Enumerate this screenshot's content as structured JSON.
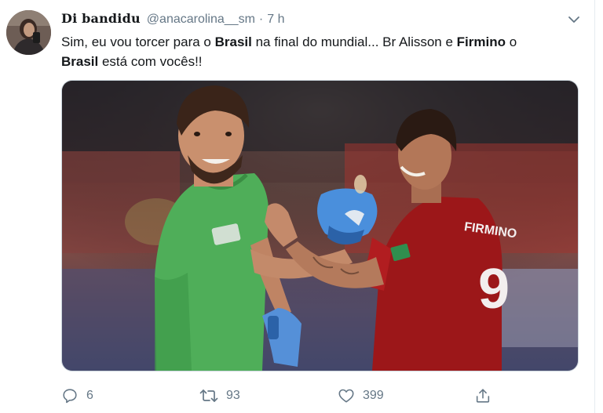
{
  "tweet": {
    "display_name": "Di bandidu",
    "handle": "@anacarolina__sm",
    "separator": "·",
    "time": "7 h",
    "text": {
      "p1": "Sim, eu vou torcer para o ",
      "b1": "Brasil",
      "p2": " na final do mundial... Br Alisson e ",
      "b2": "Firmino",
      "p3": " o ",
      "b3": "Brasil",
      "p4": " está com vocês!!"
    }
  },
  "photo": {
    "jersey_number": "9",
    "jersey_name": "FIRMINO"
  },
  "actions": {
    "replies": "6",
    "retweets": "93",
    "likes": "399"
  },
  "colors": {
    "secondary_text": "#657786",
    "primary_text": "#14171a",
    "keeper_green": "#4fae59",
    "liverpool_red": "#9c1719"
  },
  "icons": [
    "caret-down-icon",
    "reply-icon",
    "retweet-icon",
    "like-icon",
    "share-icon"
  ]
}
